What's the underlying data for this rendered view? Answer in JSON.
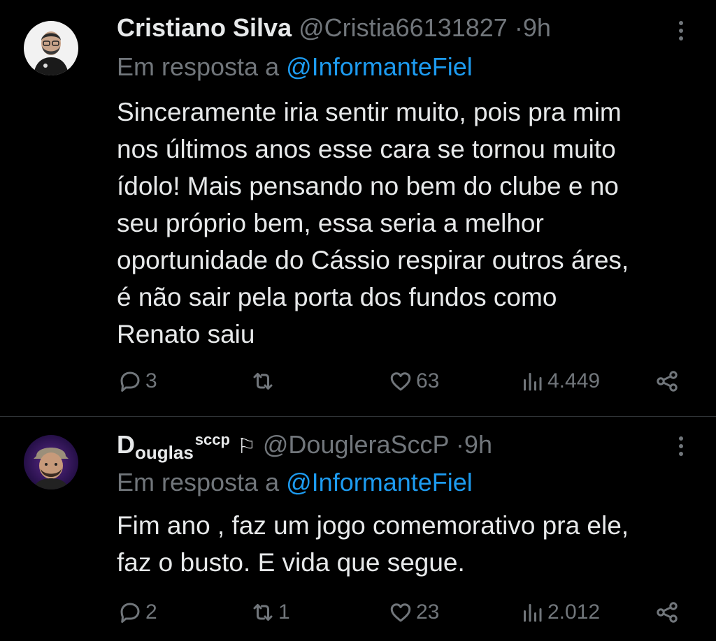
{
  "colors": {
    "background": "#000000",
    "text": "#e7e9ea",
    "secondary": "#71767b",
    "accent": "#1d9bf0",
    "divider": "#2f3336"
  },
  "tweets": [
    {
      "name": "Cristiano Silva",
      "handle": "@Cristia66131827",
      "separator": "·",
      "time": "9h",
      "reply_prefix": "Em resposta a",
      "reply_to": "@InformanteFiel",
      "text_lines": [
        "Sinceramente iria sentir muito, pois pra mim",
        "nos últimos anos esse cara se tornou muito",
        "ídolo!  Mais pensando no bem do clube e  no",
        "seu próprio bem, essa seria a melhor",
        "oportunidade do Cássio respirar outros áres,",
        "é não sair pela porta dos fundos como",
        "Renato saiu"
      ],
      "replies": "3",
      "retweets": "",
      "likes": "63",
      "views": "4.449",
      "icons": [
        "reply-icon",
        "retweet-icon",
        "heart-icon",
        "views-icon",
        "share-icon",
        "more-icon"
      ]
    },
    {
      "name_main": "D",
      "name_sub": "ouglas",
      "name_sup": "sccp",
      "flag": "⚐",
      "handle": "@DougleraSccP",
      "separator": "·",
      "time": "9h",
      "reply_prefix": "Em resposta a",
      "reply_to": "@InformanteFiel",
      "text_lines": [
        "Fim ano , faz um jogo comemorativo pra ele,",
        "faz o busto. E vida que segue."
      ],
      "replies": "2",
      "retweets": "1",
      "likes": "23",
      "views": "2.012",
      "icons": [
        "reply-icon",
        "retweet-icon",
        "heart-icon",
        "views-icon",
        "share-icon",
        "more-icon"
      ]
    }
  ]
}
